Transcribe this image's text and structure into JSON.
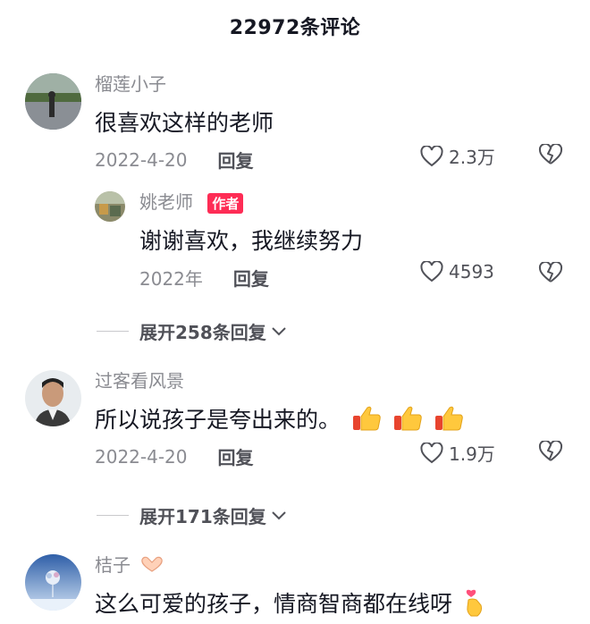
{
  "header": {
    "title": "22972条评论"
  },
  "comments": [
    {
      "name": "榴莲小子",
      "text": "很喜欢这样的老师",
      "date": "2022-4-20",
      "reply_label": "回复",
      "likes": "2.3万",
      "replies": [
        {
          "name": "姚老师",
          "badge": "作者",
          "text": "谢谢喜欢，我继续努力",
          "date": "2022年",
          "reply_label": "回复",
          "likes": "4593"
        }
      ],
      "expand_label": "展开258条回复"
    },
    {
      "name": "过客看风景",
      "text": "所以说孩子是夸出来的。",
      "date": "2022-4-20",
      "reply_label": "回复",
      "likes": "1.9万",
      "expand_label": "展开171条回复"
    },
    {
      "name": "桔子",
      "text": "这么可爱的孩子，情商智商都在线呀"
    }
  ],
  "colors": {
    "accent": "#fe2c55",
    "muted": "#8a8b91",
    "text": "#161823"
  },
  "icons": [
    "heart-icon",
    "broken-heart-icon",
    "chevron-down-icon",
    "thumbs-up-icon",
    "heart-hands-icon",
    "finger-heart-icon"
  ]
}
